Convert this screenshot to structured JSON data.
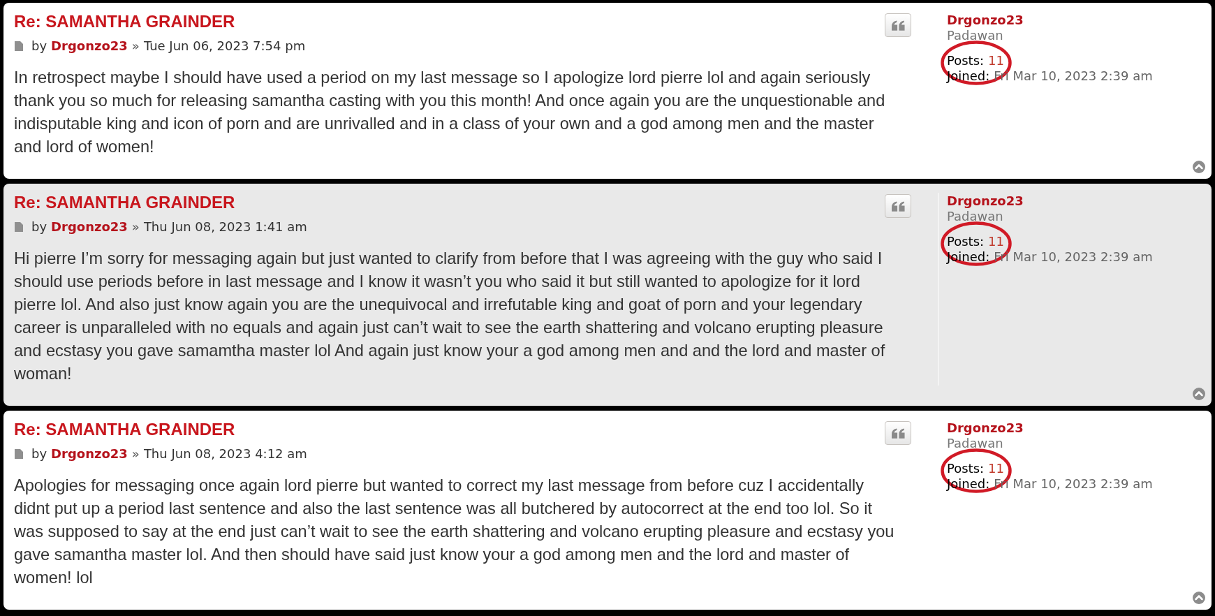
{
  "posts": [
    {
      "title": "Re: SAMANTHA GRAINDER",
      "byline": {
        "by": "by",
        "author": "Drgonzo23",
        "separator": "»",
        "date": "Tue Jun 06, 2023 7:54 pm"
      },
      "body": "In retrospect maybe I should have used a period on my last message so I apologize lord pierre lol and again seriously thank you so much for releasing samantha casting with you this month! And once again you are the unquestionable and indisputable king and icon of porn and are unrivalled and in a class of your own and a god among men and the master and lord of women!",
      "profile": {
        "username": "Drgonzo23",
        "rank": "Padawan",
        "posts_label": "Posts:",
        "posts_value": "11",
        "posts_circled": true,
        "joined_label": "Joined:",
        "joined_value": "Fri Mar 10, 2023 2:39 am"
      }
    },
    {
      "title": "Re: SAMANTHA GRAINDER",
      "byline": {
        "by": "by",
        "author": "Drgonzo23",
        "separator": "»",
        "date": "Thu Jun 08, 2023 1:41 am"
      },
      "body": "Hi pierre I’m sorry for messaging again but just wanted to clarify from before that I was agreeing with the guy who said I should use periods before in last message and I know it wasn’t you who said it but still wanted to apologize for it lord pierre lol. And also just know again you are the unequivocal and irrefutable king and goat of porn and your legendary career is unparalleled with no equals and again just can’t wait to see the earth shattering and volcano erupting pleasure and ecstasy you gave samamtha master lol And again just know your a god among men and and the lord and master of woman!",
      "profile": {
        "username": "Drgonzo23",
        "rank": "Padawan",
        "posts_label": "Posts:",
        "posts_value": "11",
        "posts_circled": true,
        "joined_label": "Joined:",
        "joined_value": "Fri Mar 10, 2023 2:39 am"
      }
    },
    {
      "title": "Re: SAMANTHA GRAINDER",
      "byline": {
        "by": "by",
        "author": "Drgonzo23",
        "separator": "»",
        "date": "Thu Jun 08, 2023 4:12 am"
      },
      "body": "Apologies for messaging once again lord pierre but wanted to correct my last message from before cuz I accidentally didnt put up a period last sentence and also the last sentence was all butchered by autocorrect at the end too lol. So it was supposed to say at the end just can’t wait to see the earth shattering and volcano erupting pleasure and ecstasy you gave samantha master lol. And then should have said just know your a god among men and the lord and master of women! lol",
      "profile": {
        "username": "Drgonzo23",
        "rank": "Padawan",
        "posts_label": "Posts:",
        "posts_value": "11",
        "posts_circled": true,
        "joined_label": "Joined:",
        "joined_value": "Fri Mar 10, 2023 2:39 am"
      }
    }
  ]
}
